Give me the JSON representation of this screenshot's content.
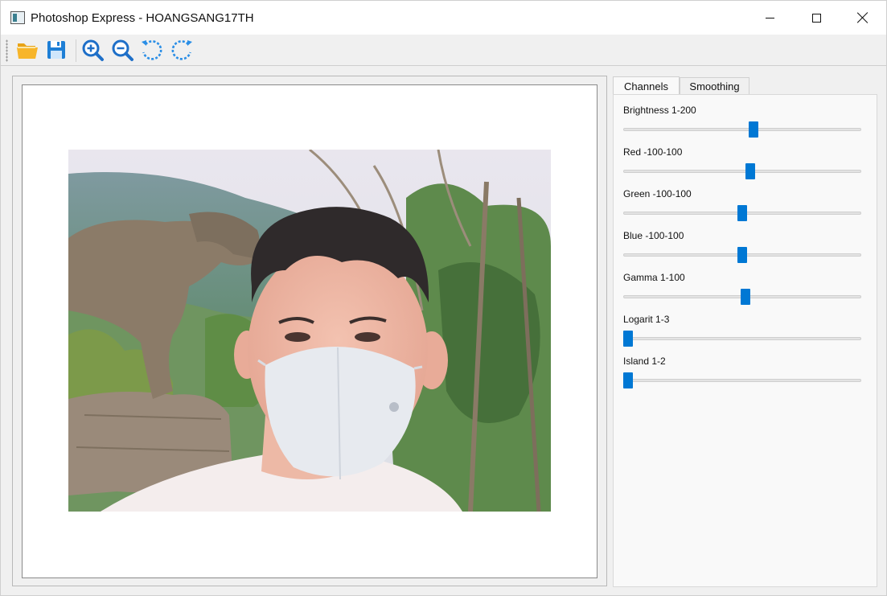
{
  "window": {
    "title": "Photoshop Express - HOANGSANG17TH"
  },
  "toolbar": {
    "buttons": [
      {
        "icon": "folder-open-icon",
        "action": "open"
      },
      {
        "icon": "save-icon",
        "action": "save"
      },
      {
        "icon": "zoom-in-icon",
        "action": "zoom-in"
      },
      {
        "icon": "zoom-out-icon",
        "action": "zoom-out"
      },
      {
        "icon": "rotate-left-icon",
        "action": "rotate-left"
      },
      {
        "icon": "rotate-right-icon",
        "action": "rotate-right"
      }
    ]
  },
  "tabs": {
    "channels": "Channels",
    "smoothing": "Smoothing",
    "active": "Channels"
  },
  "sliders": [
    {
      "label": "Brightness 1-200",
      "min": 1,
      "max": 200,
      "value": 110
    },
    {
      "label": "Red -100-100",
      "min": -100,
      "max": 100,
      "value": 7
    },
    {
      "label": "Green -100-100",
      "min": -100,
      "max": 100,
      "value": 0
    },
    {
      "label": "Blue -100-100",
      "min": -100,
      "max": 100,
      "value": 0
    },
    {
      "label": "Gamma 1-100",
      "min": 1,
      "max": 100,
      "value": 52
    },
    {
      "label": "Logarit 1-3",
      "min": 1,
      "max": 3,
      "value": 1
    },
    {
      "label": "Island 1-2",
      "min": 1,
      "max": 2,
      "value": 1
    }
  ],
  "colors": {
    "accent": "#0078d4",
    "window_bg": "#f0f0f0",
    "panel_bg": "#f9f9f9"
  }
}
